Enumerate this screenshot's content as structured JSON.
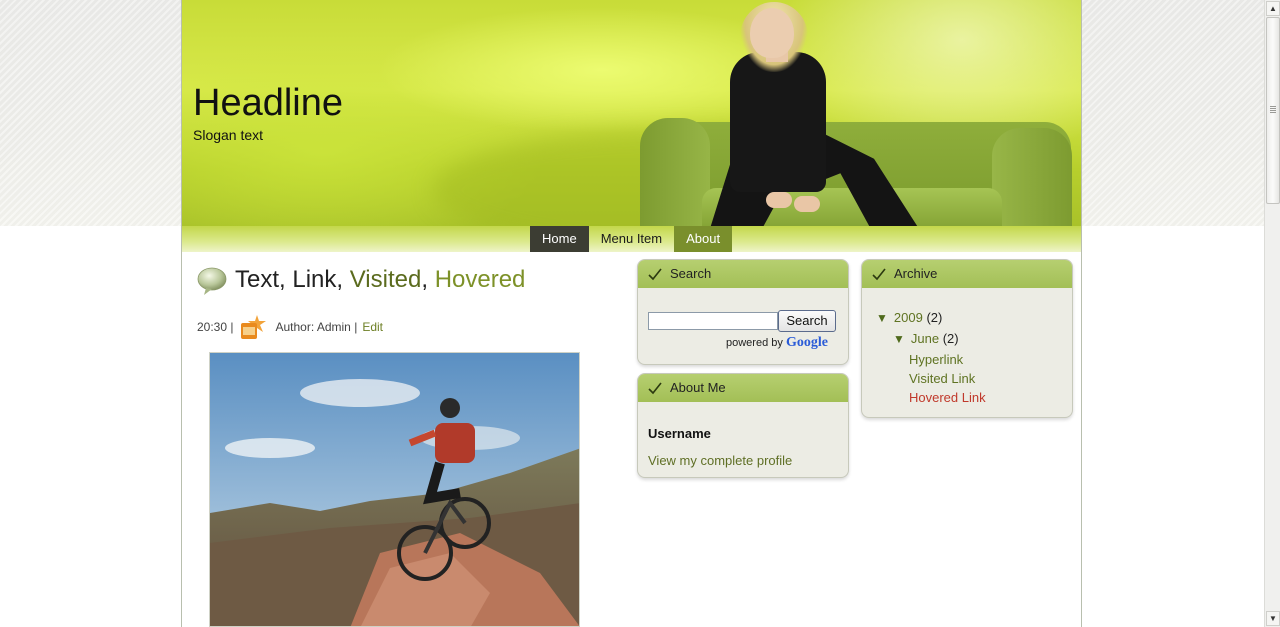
{
  "header": {
    "headline": "Headline",
    "slogan": "Slogan text"
  },
  "nav": {
    "items": [
      {
        "label": "Home"
      },
      {
        "label": "Menu Item"
      },
      {
        "label": "About"
      }
    ]
  },
  "post": {
    "title_parts": {
      "text": "Text",
      "link": "Link",
      "visited": "Visited",
      "hovered": "Hovered",
      "sep": ", "
    },
    "time": "20:30 |",
    "author": "Author: Admin |",
    "edit": "Edit",
    "icons": {
      "post": "speech-bubble-icon",
      "author": "author-badge-icon"
    }
  },
  "search_widget": {
    "title": "Search",
    "button": "Search",
    "powered_by": "powered by",
    "google": "Google"
  },
  "about_widget": {
    "title": "About Me",
    "username": "Username",
    "profile_link": "View my complete profile"
  },
  "archive_widget": {
    "title": "Archive",
    "year": {
      "label": "2009",
      "count": "(2)"
    },
    "month": {
      "label": "June",
      "count": "(2)"
    },
    "links": [
      "Hyperlink",
      "Visited Link",
      "Hovered Link"
    ]
  },
  "colors": {
    "accent_green": "#a3bf56",
    "link_green": "#5f7322",
    "hover_red": "#c0392b",
    "nav_dark": "#3c3d33"
  }
}
